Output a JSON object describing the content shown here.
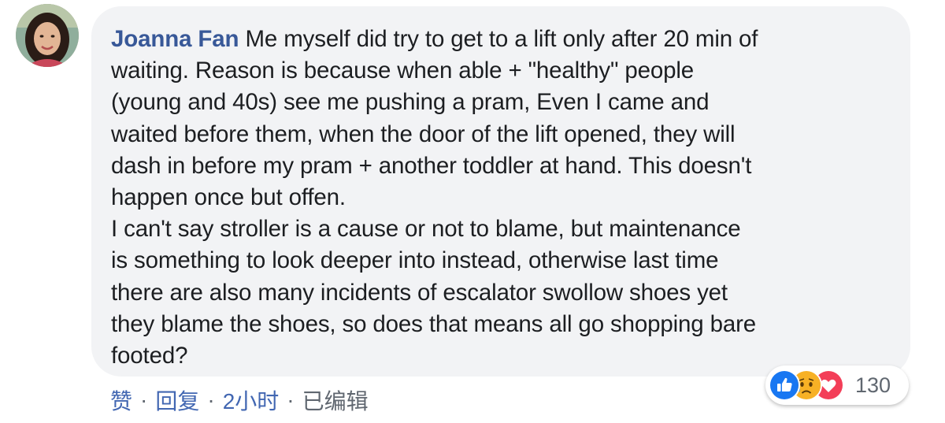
{
  "comment": {
    "author": "Joanna Fan",
    "body": " Me myself did try to get to a lift only after 20 min of\nwaiting. Reason is because when able + \"healthy\" people\n(young and 40s) see me pushing a pram, Even I came and\nwaited before them, when the door of the lift opened, they will\ndash in before my pram + another toddler at hand. This doesn't\nhappen once but offen.\nI can't say stroller is a cause or not to blame, but maintenance\nis something to look deeper into instead, otherwise last time\nthere are also many incidents of escalator swollow shoes yet\nthey blame the shoes, so does that means all go shopping bare\nfooted?"
  },
  "actions": {
    "like": "赞",
    "reply": "回复",
    "time": "2小时",
    "edited": "已编辑",
    "separator": "·"
  },
  "reactions": {
    "types": [
      "like-icon",
      "sad-icon",
      "love-icon"
    ],
    "count": "130"
  },
  "colors": {
    "bubble": "#f2f3f5",
    "author": "#385898",
    "link": "#4267b2",
    "meta": "#606770",
    "like": "#1877f2",
    "sad": "#f7b125",
    "love": "#f33e58"
  }
}
